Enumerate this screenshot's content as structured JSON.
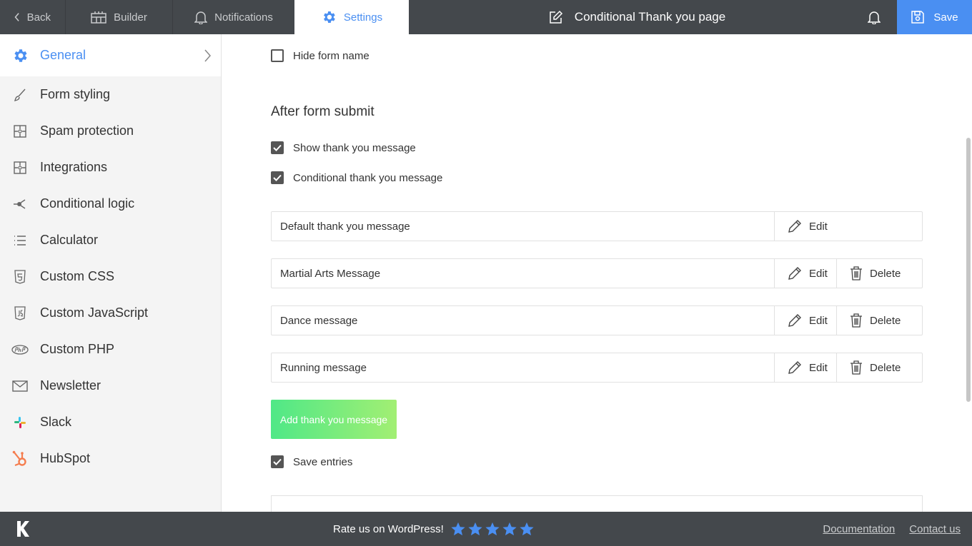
{
  "topbar": {
    "back_label": "Back",
    "builder_label": "Builder",
    "notifications_label": "Notifications",
    "settings_label": "Settings",
    "form_title": "Conditional Thank you page",
    "save_label": "Save",
    "accent_color": "#4a8ff2"
  },
  "sidebar": {
    "items": [
      {
        "label": "General",
        "icon": "gear-icon",
        "active": true
      },
      {
        "label": "Form styling",
        "icon": "brush-icon"
      },
      {
        "label": "Spam protection",
        "icon": "puzzle-icon"
      },
      {
        "label": "Integrations",
        "icon": "puzzle-icon"
      },
      {
        "label": "Conditional logic",
        "icon": "branch-icon"
      },
      {
        "label": "Calculator",
        "icon": "list-icon"
      },
      {
        "label": "Custom CSS",
        "icon": "css-icon"
      },
      {
        "label": "Custom JavaScript",
        "icon": "js-icon"
      },
      {
        "label": "Custom PHP",
        "icon": "php-icon"
      },
      {
        "label": "Newsletter",
        "icon": "envelope-icon"
      },
      {
        "label": "Slack",
        "icon": "slack-icon"
      },
      {
        "label": "HubSpot",
        "icon": "hubspot-icon"
      }
    ]
  },
  "main": {
    "hide_form_name": {
      "label": "Hide form name",
      "checked": false
    },
    "after_submit_title": "After form submit",
    "show_thank_you": {
      "label": "Show thank you message",
      "checked": true
    },
    "conditional_thank_you": {
      "label": "Conditional thank you message",
      "checked": true
    },
    "messages": [
      {
        "name": "Default thank you message",
        "edit_label": "Edit"
      },
      {
        "name": "Martial Arts Message",
        "edit_label": "Edit",
        "delete_label": "Delete"
      },
      {
        "name": "Dance message",
        "edit_label": "Edit",
        "delete_label": "Delete"
      },
      {
        "name": "Running message",
        "edit_label": "Edit",
        "delete_label": "Delete"
      }
    ],
    "add_button_label": "Add thank you message",
    "save_entries": {
      "label": "Save entries",
      "checked": true
    }
  },
  "footer": {
    "rate_text": "Rate us on WordPress!",
    "stars": 5,
    "star_color": "#4a8ff2",
    "documentation_label": "Documentation",
    "contact_label": "Contact us"
  }
}
